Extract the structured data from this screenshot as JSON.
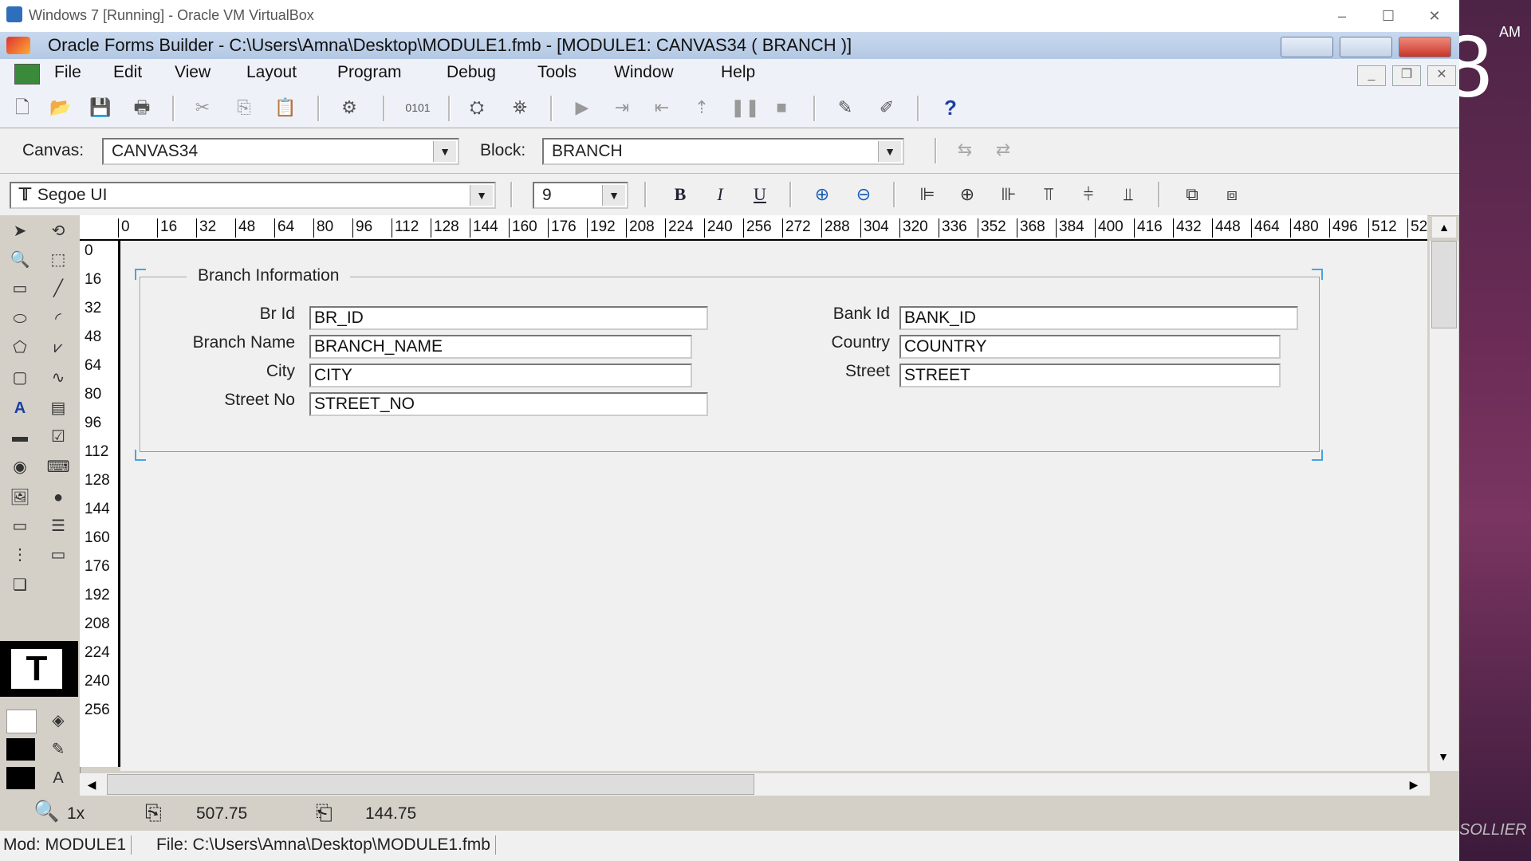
{
  "host": {
    "title": "Windows 7 [Running] - Oracle VM VirtualBox",
    "minimize": "–",
    "maximize": "☐",
    "close": "✕"
  },
  "desktop": {
    "time_suffix": "AM",
    "big_digit": "8",
    "watermark": "SOLLIER"
  },
  "app": {
    "title": "Oracle Forms Builder - C:\\Users\\Amna\\Desktop\\MODULE1.fmb - [MODULE1: CANVAS34 ( BRANCH )]"
  },
  "menu": [
    "File",
    "Edit",
    "View",
    "Layout",
    "Program",
    "Debug",
    "Tools",
    "Window",
    "Help"
  ],
  "bar2": {
    "canvas_label": "Canvas:",
    "canvas_value": "CANVAS34",
    "block_label": "Block:",
    "block_value": "BRANCH"
  },
  "bar3": {
    "font_value": "Segoe UI",
    "size_value": "9",
    "bold": "B",
    "italic": "I",
    "underline": "U"
  },
  "ruler_h": [
    "0",
    "16",
    "32",
    "48",
    "64",
    "80",
    "96",
    "112",
    "128",
    "144",
    "160",
    "176",
    "192",
    "208",
    "224",
    "240",
    "256",
    "272",
    "288",
    "304",
    "320",
    "336",
    "352",
    "368",
    "384",
    "400",
    "416",
    "432",
    "448",
    "464",
    "480",
    "496",
    "512",
    "52"
  ],
  "ruler_v": [
    "0",
    "16",
    "32",
    "48",
    "64",
    "80",
    "96",
    "112",
    "128",
    "144",
    "160",
    "176",
    "192",
    "208",
    "224",
    "240",
    "256"
  ],
  "frame": {
    "title": "Branch Information",
    "fields_left": [
      {
        "label": "Br Id",
        "value": "BR_ID"
      },
      {
        "label": "Branch Name",
        "value": "BRANCH_NAME"
      },
      {
        "label": "City",
        "value": "CITY"
      },
      {
        "label": "Street No",
        "value": "STREET_NO"
      }
    ],
    "fields_right": [
      {
        "label": "Bank Id",
        "value": "BANK_ID"
      },
      {
        "label": "Country",
        "value": "COUNTRY"
      },
      {
        "label": "Street",
        "value": "STREET"
      }
    ]
  },
  "status": {
    "zoom": "1x",
    "x_pos": "507.75",
    "y_pos": "144.75",
    "module": "Mod: MODULE1",
    "file": "File: C:\\Users\\Amna\\Desktop\\MODULE1.fmb"
  }
}
